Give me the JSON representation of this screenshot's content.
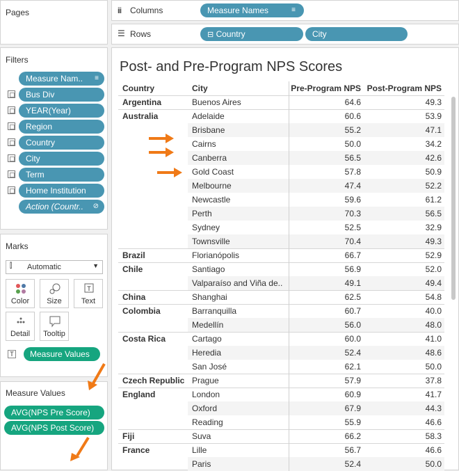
{
  "pages": {
    "title": "Pages"
  },
  "shelves": {
    "columns_label": "Columns",
    "columns_pill": "Measure Names",
    "rows_label": "Rows",
    "rows_pills": [
      "Country",
      "City"
    ]
  },
  "filters": {
    "title": "Filters",
    "items": [
      "Measure Nam..",
      "Bus Div",
      "YEAR(Year)",
      "Region",
      "Country",
      "City",
      "Term",
      "Home Institution",
      "Action (Countr.."
    ]
  },
  "marks": {
    "title": "Marks",
    "type": "Automatic",
    "buttons": [
      "Color",
      "Size",
      "Text",
      "Detail",
      "Tooltip"
    ],
    "text_pill": "Measure Values",
    "text_icon": "T"
  },
  "measure_values": {
    "title": "Measure Values",
    "items": [
      "AVG(NPS Pre Score)",
      "AVG(NPS Post Score)"
    ]
  },
  "viz": {
    "title": "Post- and Pre-Program NPS Scores",
    "headers": [
      "Country",
      "City",
      "Pre-Program NPS",
      "Post-Program NPS"
    ],
    "rows": [
      {
        "country": "Argentina",
        "city": "Buenos Aires",
        "pre": "64.6",
        "post": "49.3"
      },
      {
        "country": "Australia",
        "city": "Adelaide",
        "pre": "60.6",
        "post": "53.9"
      },
      {
        "country": "",
        "city": "Brisbane",
        "pre": "55.2",
        "post": "47.1"
      },
      {
        "country": "",
        "city": "Cairns",
        "pre": "50.0",
        "post": "34.2"
      },
      {
        "country": "",
        "city": "Canberra",
        "pre": "56.5",
        "post": "42.6"
      },
      {
        "country": "",
        "city": "Gold Coast",
        "pre": "57.8",
        "post": "50.9"
      },
      {
        "country": "",
        "city": "Melbourne",
        "pre": "47.4",
        "post": "52.2"
      },
      {
        "country": "",
        "city": "Newcastle",
        "pre": "59.6",
        "post": "61.2"
      },
      {
        "country": "",
        "city": "Perth",
        "pre": "70.3",
        "post": "56.5"
      },
      {
        "country": "",
        "city": "Sydney",
        "pre": "52.5",
        "post": "32.9"
      },
      {
        "country": "",
        "city": "Townsville",
        "pre": "70.4",
        "post": "49.3"
      },
      {
        "country": "Brazil",
        "city": "Florianópolis",
        "pre": "66.7",
        "post": "52.9"
      },
      {
        "country": "Chile",
        "city": "Santiago",
        "pre": "56.9",
        "post": "52.0"
      },
      {
        "country": "",
        "city": "Valparaíso and Viña de..",
        "pre": "49.1",
        "post": "49.4"
      },
      {
        "country": "China",
        "city": "Shanghai",
        "pre": "62.5",
        "post": "54.8"
      },
      {
        "country": "Colombia",
        "city": "Barranquilla",
        "pre": "60.7",
        "post": "40.0"
      },
      {
        "country": "",
        "city": "Medellín",
        "pre": "56.0",
        "post": "48.0"
      },
      {
        "country": "Costa Rica",
        "city": "Cartago",
        "pre": "60.0",
        "post": "41.0"
      },
      {
        "country": "",
        "city": "Heredia",
        "pre": "52.4",
        "post": "48.6"
      },
      {
        "country": "",
        "city": "San José",
        "pre": "62.1",
        "post": "50.0"
      },
      {
        "country": "Czech Republic",
        "city": "Prague",
        "pre": "57.9",
        "post": "37.8"
      },
      {
        "country": "England",
        "city": "London",
        "pre": "60.9",
        "post": "41.7"
      },
      {
        "country": "",
        "city": "Oxford",
        "pre": "67.9",
        "post": "44.3"
      },
      {
        "country": "",
        "city": "Reading",
        "pre": "55.9",
        "post": "46.6"
      },
      {
        "country": "Fiji",
        "city": "Suva",
        "pre": "66.2",
        "post": "58.3"
      },
      {
        "country": "France",
        "city": "Lille",
        "pre": "56.7",
        "post": "46.6"
      },
      {
        "country": "",
        "city": "Paris",
        "pre": "52.4",
        "post": "50.0"
      }
    ]
  },
  "colors": {
    "blue_pill": "#4996b2",
    "green_pill": "#16a57f",
    "arrow": "#f07a17"
  }
}
